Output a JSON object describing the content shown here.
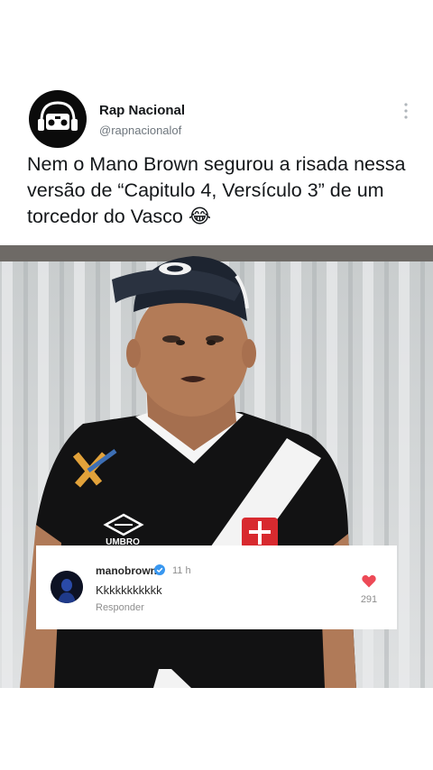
{
  "post": {
    "display_name": "Rap Nacional",
    "handle": "@rapnacionalof",
    "text": "Nem o Mano Brown segurou a risada nessa versão de “Capitulo 4, Versículo 3” de um torcedor do Vasco 😂",
    "icons": {
      "avatar": "boombox-headphones-logo",
      "menu": "vertical-dots-icon"
    }
  },
  "video": {
    "scene": "man in Vasco jersey and cap in front of corrugated wall",
    "jersey_brand": "UMBRO"
  },
  "comment": {
    "username": "manobrown",
    "verified": true,
    "time": "11 h",
    "text": "Kkkkkkkkkkk",
    "reply_label": "Responder",
    "likes": "291",
    "heart_color": "#ed4956",
    "verified_color": "#3897f0"
  }
}
